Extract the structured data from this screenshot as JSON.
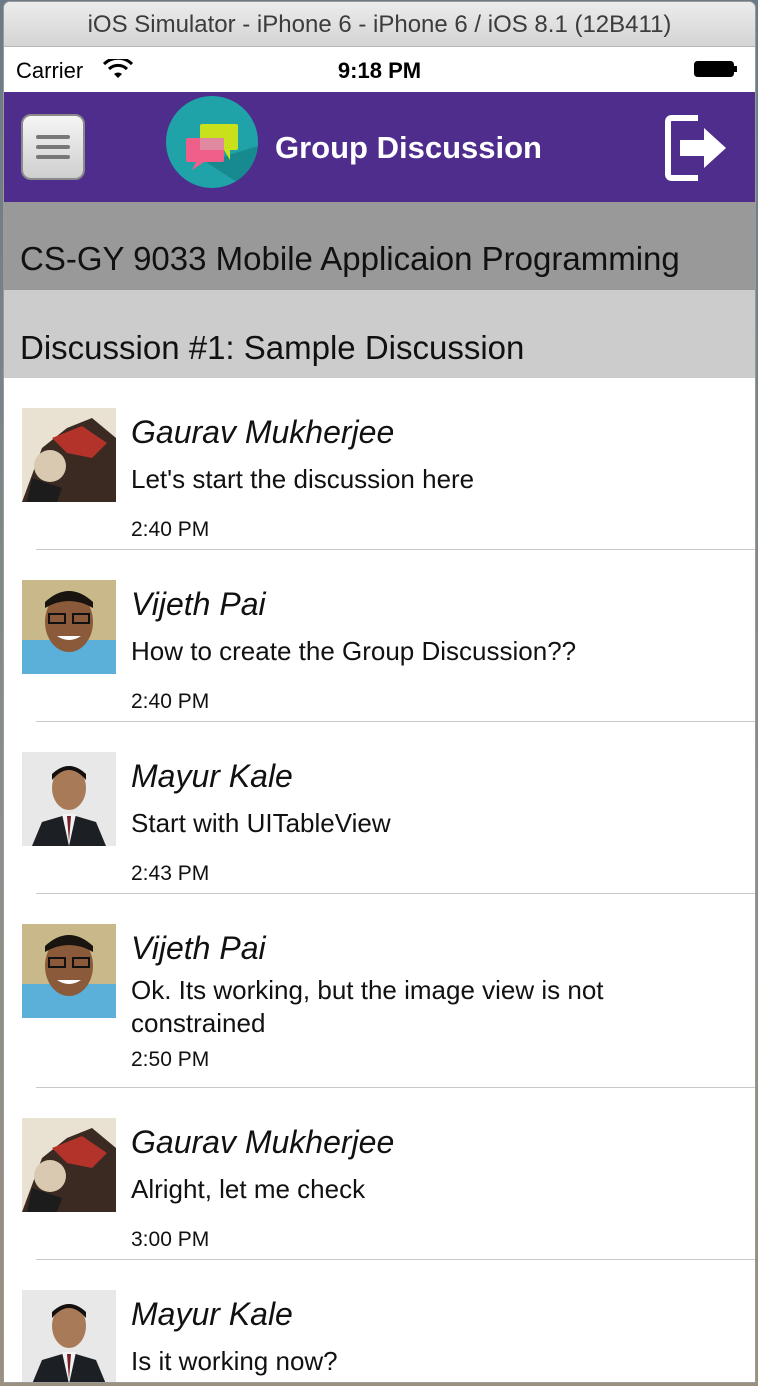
{
  "window": {
    "title": "iOS Simulator - iPhone 6 - iPhone 6 / iOS 8.1 (12B411)"
  },
  "status_bar": {
    "carrier": "Carrier",
    "time": "9:18 PM"
  },
  "nav": {
    "title": "Group Discussion"
  },
  "course": {
    "title": "CS-GY 9033 Mobile Applicaion Programming"
  },
  "discussion": {
    "title": "Discussion #1: Sample Discussion"
  },
  "colors": {
    "nav_bg": "#4f2d8d",
    "course_bg": "#999999",
    "discussion_bg": "#cccccc",
    "logo_bg": "#1fa3a8"
  },
  "messages": [
    {
      "author": "Gaurav Mukherjee",
      "text": "Let's start the discussion here",
      "time": "2:40 PM"
    },
    {
      "author": "Vijeth Pai",
      "text": "How to create the Group Discussion??",
      "time": "2:40 PM"
    },
    {
      "author": "Mayur Kale",
      "text": "Start with UITableView",
      "time": "2:43 PM"
    },
    {
      "author": "Vijeth Pai",
      "text": "Ok. Its working, but the image view is not constrained",
      "time": "2:50 PM"
    },
    {
      "author": "Gaurav Mukherjee",
      "text": "Alright, let me check",
      "time": "3:00 PM"
    },
    {
      "author": "Mayur Kale",
      "text": "Is it working now?",
      "time": ""
    }
  ]
}
